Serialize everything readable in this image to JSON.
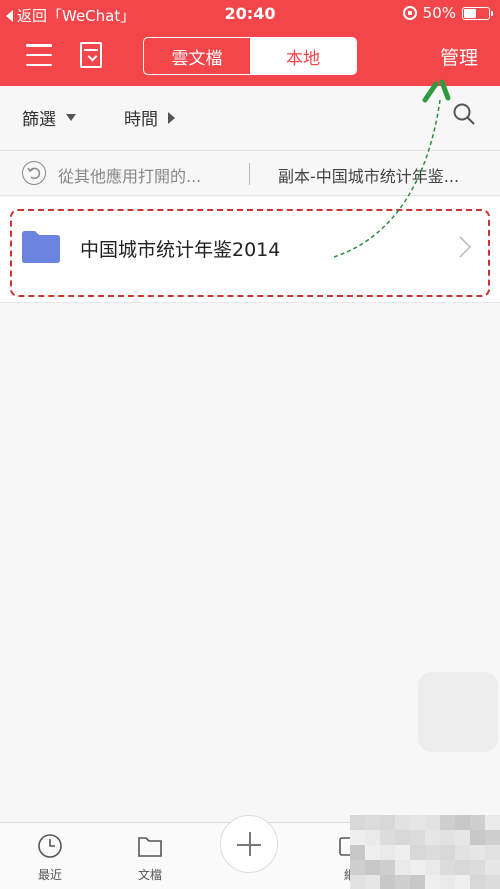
{
  "status_bar": {
    "back_label": "返回「WeChat」",
    "time": "20:40",
    "battery_text": "50%",
    "battery_level": 0.5
  },
  "header": {
    "tabs": [
      {
        "label": "雲文檔",
        "active": false
      },
      {
        "label": "本地",
        "active": true
      }
    ],
    "manage_label": "管理"
  },
  "filter_bar": {
    "filter_label": "篩選",
    "time_label": "時間"
  },
  "breadcrumb": {
    "back_label": "從其他應用打開的...",
    "current_label": "副本-中国城市统计年鉴..."
  },
  "file_list": [
    {
      "name": "中国城市统计年鉴2014",
      "type": "folder"
    }
  ],
  "bottom_nav": {
    "items": [
      {
        "label": "最近",
        "icon": "clock-icon"
      },
      {
        "label": "文檔",
        "icon": "folder-outline-icon"
      },
      {
        "label": "網",
        "icon": "square-icon"
      }
    ]
  },
  "colors": {
    "brand": "#f2464b",
    "folder": "#6b84e0",
    "annotation_box": "#cc3333",
    "annotation_arrow": "#2e8b3e"
  }
}
